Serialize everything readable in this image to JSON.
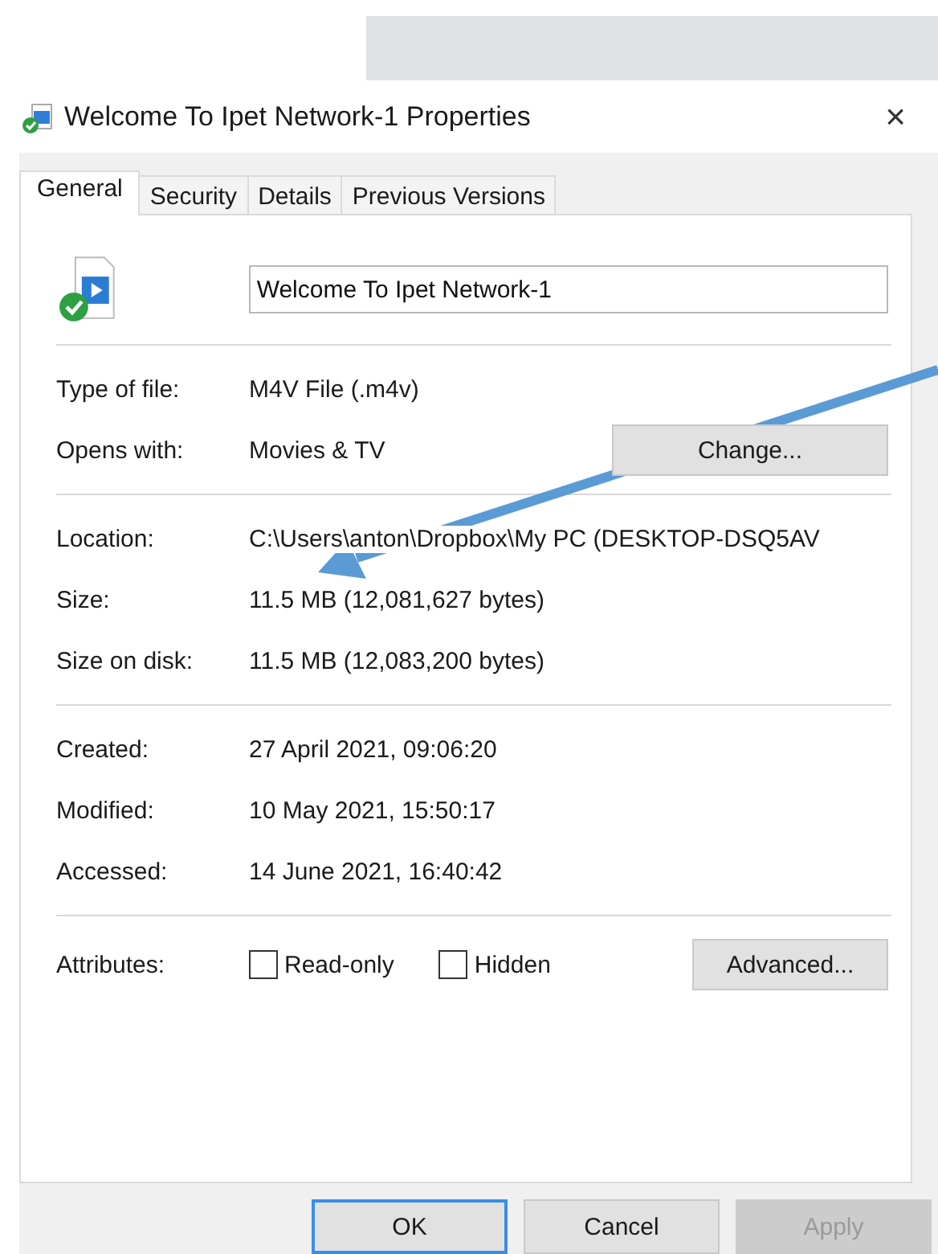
{
  "window": {
    "title": "Welcome To Ipet Network-1 Properties",
    "close": "×"
  },
  "tabs": [
    {
      "label": "General",
      "selected": true
    },
    {
      "label": "Security",
      "selected": false
    },
    {
      "label": "Details",
      "selected": false
    },
    {
      "label": "Previous Versions",
      "selected": false
    }
  ],
  "file_name": {
    "value": "Welcome To Ipet Network-1"
  },
  "sections": [
    {
      "rows": [
        {
          "label": "Type of file:",
          "value": "M4V File (.m4v)"
        },
        {
          "label": "Opens with:",
          "value": "Movies & TV",
          "button": "Change..."
        }
      ]
    },
    {
      "rows": [
        {
          "label": "Location:",
          "value": "C:\\Users\\anton\\Dropbox\\My PC (DESKTOP-DSQ5AV"
        },
        {
          "label": "Size:",
          "value": "11.5 MB (12,081,627 bytes)"
        },
        {
          "label": "Size on disk:",
          "value": "11.5 MB (12,083,200 bytes)"
        }
      ]
    },
    {
      "rows": [
        {
          "label": "Created:",
          "value": "27 April 2021, 09:06:20"
        },
        {
          "label": "Modified:",
          "value": "10 May 2021, 15:50:17"
        },
        {
          "label": "Accessed:",
          "value": "14 June 2021, 16:40:42"
        }
      ]
    }
  ],
  "attributes": {
    "label": "Attributes:",
    "checkboxes": [
      {
        "label": "Read-only",
        "checked": false
      },
      {
        "label": "Hidden",
        "checked": false
      }
    ],
    "button": "Advanced..."
  },
  "buttons": [
    {
      "label": "OK",
      "default": true,
      "disabled": false
    },
    {
      "label": "Cancel",
      "default": false,
      "disabled": false
    },
    {
      "label": "Apply",
      "default": false,
      "disabled": true
    }
  ]
}
